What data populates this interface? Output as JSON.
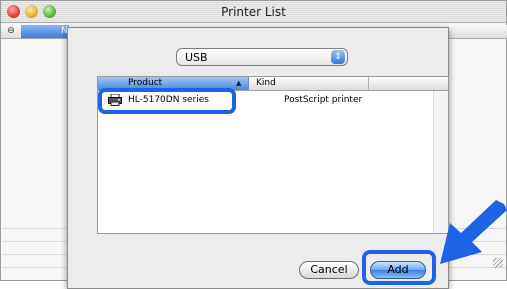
{
  "window": {
    "title": "Printer List",
    "hidden_column_label": "N",
    "left_header_glyph": "⊖"
  },
  "sheet": {
    "connection_select": {
      "value": "USB",
      "arrows_glyph": "⇕"
    },
    "table": {
      "columns": [
        {
          "label": "Product",
          "sort": "ascending",
          "sort_glyph": "▲"
        },
        {
          "label": "Kind"
        }
      ],
      "rows": [
        {
          "product": "HL-5170DN series",
          "kind": "PostScript printer",
          "icon": "printer-icon"
        }
      ]
    },
    "buttons": {
      "cancel": "Cancel",
      "add": "Add"
    }
  },
  "annotations": {
    "highlight_color": "#1e63e6",
    "highlights": [
      "product-row",
      "add-button"
    ],
    "arrow_target": "add-button"
  }
}
